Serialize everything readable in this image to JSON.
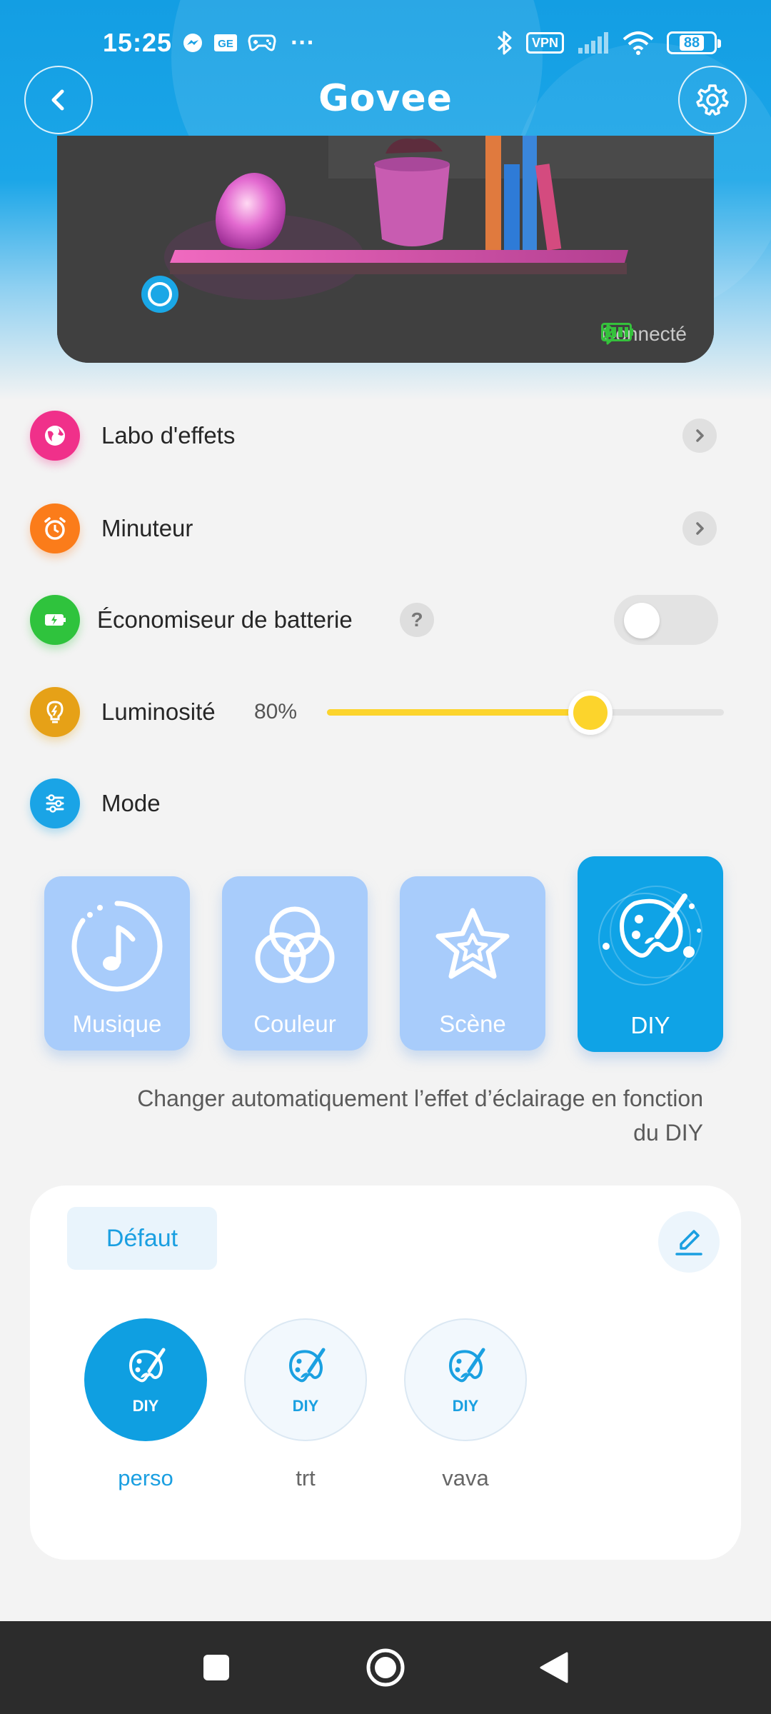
{
  "status_bar": {
    "time": "15:25",
    "vpn": "VPN",
    "battery": "88",
    "dots": "···"
  },
  "app_bar": {
    "logo": "Govee"
  },
  "device": {
    "connection": "Connecté"
  },
  "rows": {
    "effects_lab": "Labo d'effets",
    "timer": "Minuteur",
    "battery_saver": "Économiseur de batterie",
    "battery_saver_help": "?",
    "brightness": "Luminosité",
    "brightness_value": "80%",
    "brightness_level": 0.8,
    "battery_saver_on": false,
    "mode": "Mode"
  },
  "modes": {
    "items": [
      {
        "label": "Musique",
        "icon": "music-icon"
      },
      {
        "label": "Couleur",
        "icon": "color-circles-icon"
      },
      {
        "label": "Scène",
        "icon": "star-icon"
      },
      {
        "label": "DIY",
        "icon": "paint-palette-icon"
      }
    ],
    "selected": "DIY",
    "description": "Changer automatiquement l’effet d’éclairage en fonction du DIY"
  },
  "diy": {
    "tab": "Défaut",
    "tag": "DIY",
    "items": [
      {
        "name": "perso",
        "selected": true
      },
      {
        "name": "trt",
        "selected": false
      },
      {
        "name": "vava",
        "selected": false
      }
    ]
  },
  "colors": {
    "accent": "#0fa3e6",
    "slider": "#fcd42c",
    "effects_icon": "#f0308a",
    "timer_icon": "#fb7c1a",
    "battery_icon": "#2fc33d",
    "brightness_icon": "#e6a117",
    "mode_icon": "#1aa4e6"
  }
}
